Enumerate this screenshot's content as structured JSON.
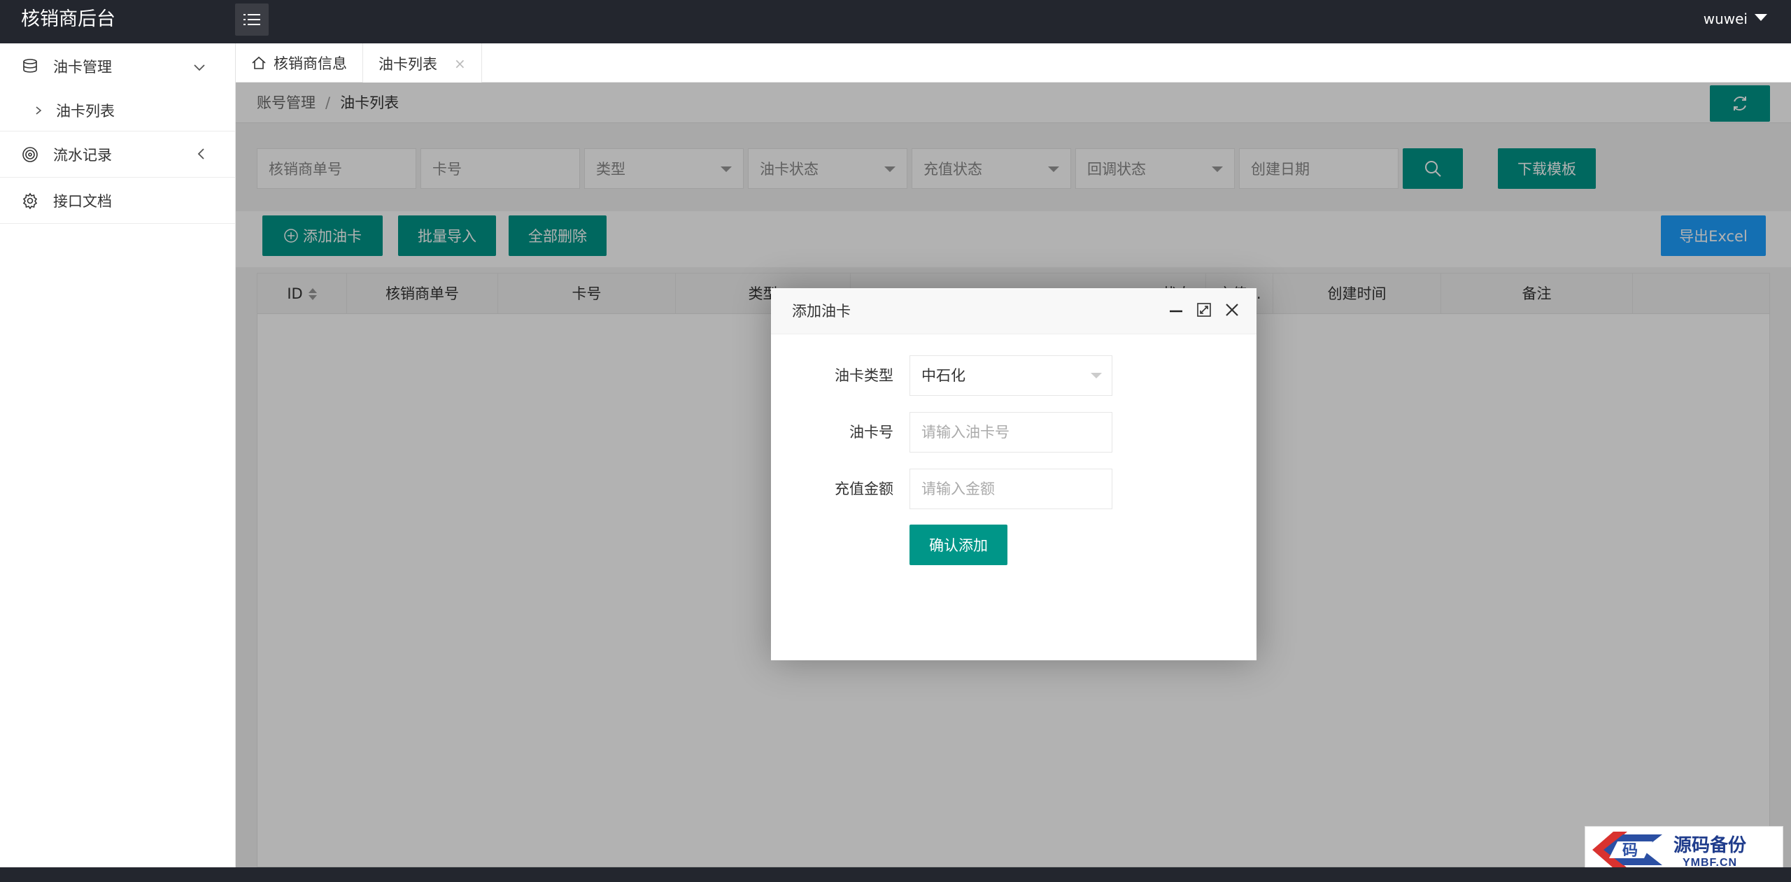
{
  "app": {
    "title": "核销商后台",
    "user": "wuwei"
  },
  "sidebar": {
    "items": [
      {
        "label": "油卡管理",
        "icon": "database-icon"
      },
      {
        "label": "油卡列表"
      },
      {
        "label": "流水记录",
        "icon": "target-icon"
      },
      {
        "label": "接口文档",
        "icon": "gear-icon"
      }
    ]
  },
  "tabs": [
    {
      "label": "核销商信息",
      "icon": "home-icon"
    },
    {
      "label": "油卡列表",
      "close": "×"
    }
  ],
  "breadcrumb": {
    "parent": "账号管理",
    "separator": "/",
    "current": "油卡列表"
  },
  "filters": {
    "merchant_no": "核销商单号",
    "card_no": "卡号",
    "type": "类型",
    "card_status": "油卡状态",
    "recharge_status": "充值状态",
    "callback_status": "回调状态",
    "created_date": "创建日期",
    "download_template": "下载模板"
  },
  "actions": {
    "add_card": "添加油卡",
    "batch_import": "批量导入",
    "delete_all": "全部删除",
    "export_excel": "导出Excel"
  },
  "table": {
    "headers": [
      "ID",
      "核销商单号",
      "卡号",
      "类型",
      "状态",
      "充值...",
      "创建时间",
      "备注"
    ]
  },
  "modal": {
    "title": "添加油卡",
    "card_type_label": "油卡类型",
    "card_type_value": "中石化",
    "card_no_label": "油卡号",
    "card_no_placeholder": "请输入油卡号",
    "amount_label": "充值金额",
    "amount_placeholder": "请输入金额",
    "confirm": "确认添加"
  },
  "watermark": {
    "main": "源码备份",
    "sub": "YMBF.CN",
    "glyph": "码"
  },
  "colors": {
    "primary": "#009688",
    "blue": "#1e9fff",
    "header": "#23262e"
  }
}
